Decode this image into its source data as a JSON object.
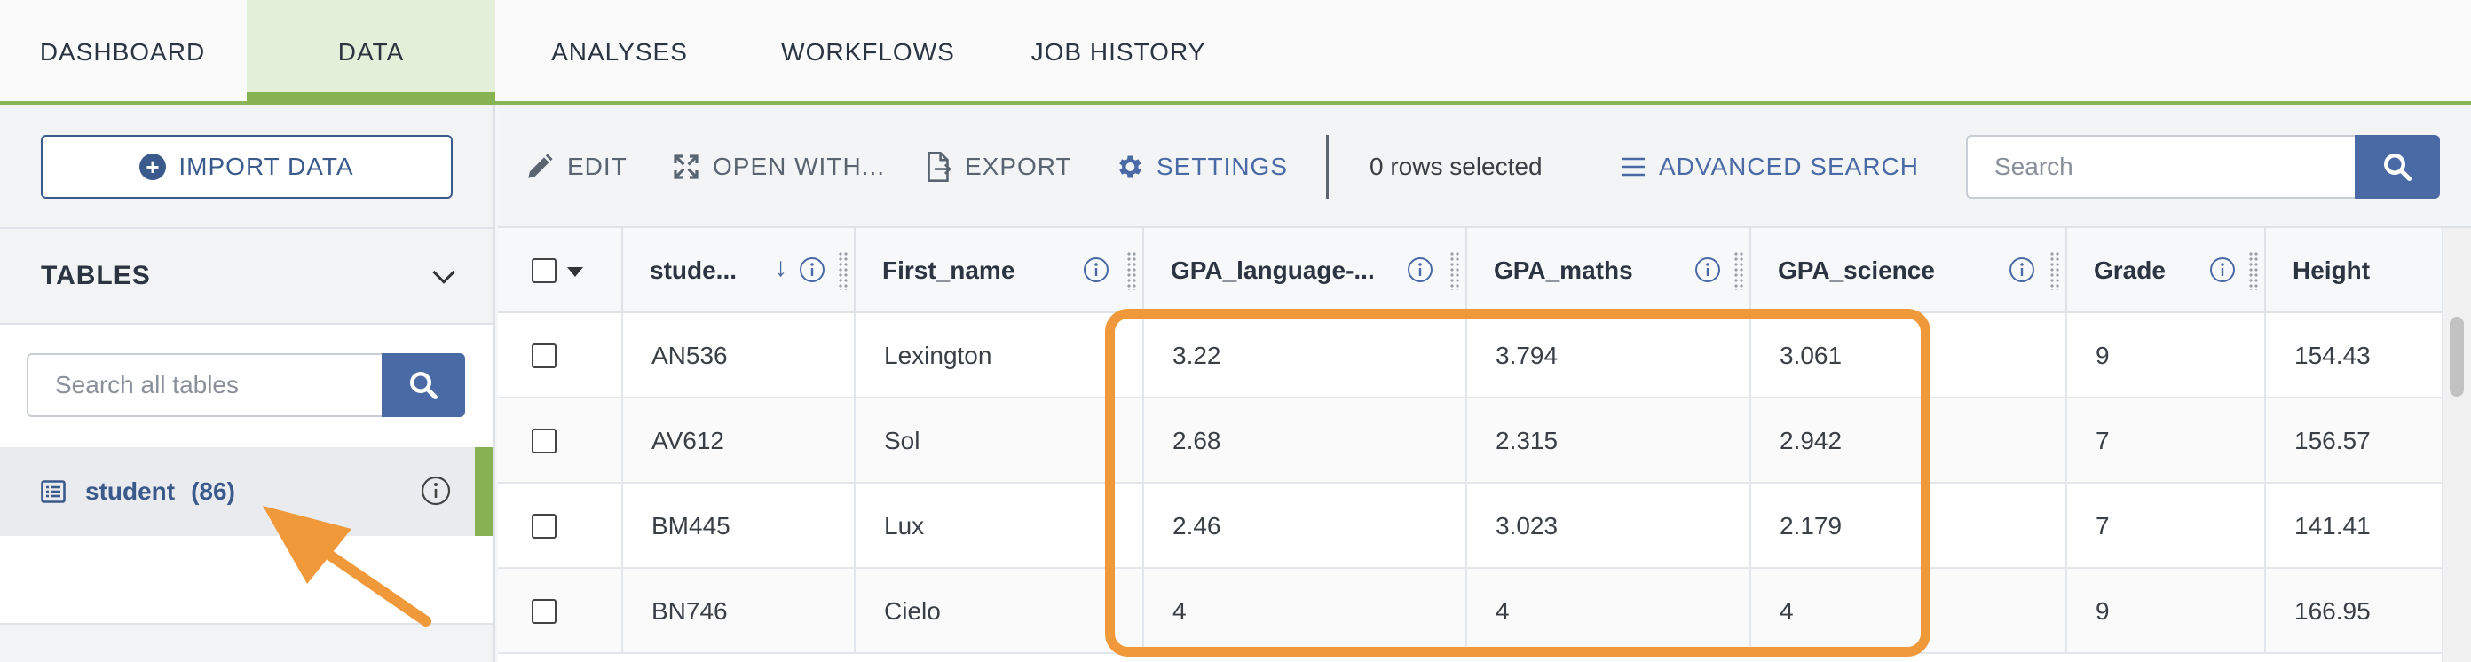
{
  "nav": {
    "tabs": [
      {
        "label": "DASHBOARD",
        "active": false
      },
      {
        "label": "DATA",
        "active": true
      },
      {
        "label": "ANALYSES",
        "active": false
      },
      {
        "label": "WORKFLOWS",
        "active": false
      },
      {
        "label": "JOB HISTORY",
        "active": false
      }
    ]
  },
  "sidebar": {
    "import_label": "IMPORT DATA",
    "tables_title": "TABLES",
    "search_placeholder": "Search all tables",
    "table_name": "student",
    "table_count": "(86)"
  },
  "toolbar": {
    "edit": "EDIT",
    "open_with": "OPEN WITH...",
    "export": "EXPORT",
    "settings": "SETTINGS",
    "rows_selected": "0 rows selected",
    "advanced_search": "ADVANCED SEARCH",
    "search_placeholder": "Search"
  },
  "grid": {
    "columns": [
      "stude...",
      "First_name",
      "GPA_language-...",
      "GPA_maths",
      "GPA_science",
      "Grade",
      "Height"
    ],
    "rows": [
      [
        "AN536",
        "Lexington",
        "3.22",
        "3.794",
        "3.061",
        "9",
        "154.43"
      ],
      [
        "AV612",
        "Sol",
        "2.68",
        "2.315",
        "2.942",
        "7",
        "156.57"
      ],
      [
        "BM445",
        "Lux",
        "2.46",
        "3.023",
        "2.179",
        "7",
        "141.41"
      ],
      [
        "BN746",
        "Cielo",
        "4",
        "4",
        "4",
        "9",
        "166.95"
      ]
    ]
  },
  "colors": {
    "accent_green": "#86b252",
    "primary_blue": "#4a6aa5",
    "highlight_orange": "#f0993a"
  }
}
